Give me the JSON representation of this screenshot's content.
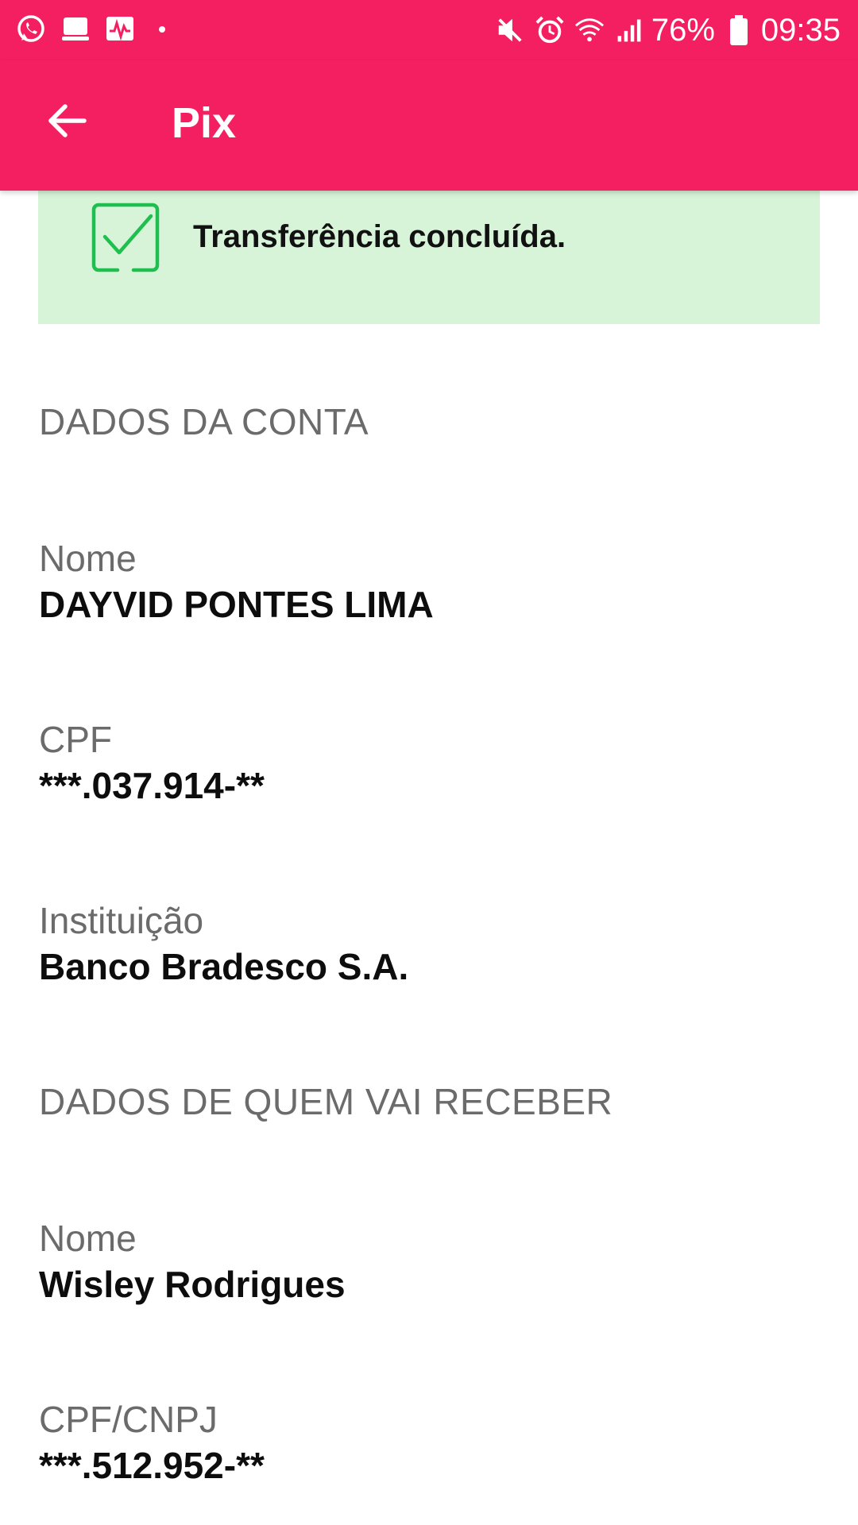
{
  "status_bar": {
    "battery_percent": "76%",
    "time": "09:35",
    "left_icons": [
      "whatsapp-icon",
      "app-stack-icon",
      "pulse-icon"
    ],
    "right_icons": [
      "mute-icon",
      "alarm-icon",
      "wifi-icon",
      "signal-icon",
      "battery-icon"
    ]
  },
  "app_bar": {
    "title": "Pix",
    "back_icon": "back-arrow-icon",
    "background_color": "#f31f60"
  },
  "banner": {
    "text": "Transferência concluída.",
    "icon": "check-square-icon",
    "background_color": "#d7f4d8",
    "icon_color": "#1fbf4f"
  },
  "account_section": {
    "title": "DADOS DA CONTA",
    "fields": [
      {
        "label": "Nome",
        "value": "DAYVID PONTES LIMA"
      },
      {
        "label": "CPF",
        "value": "***.037.914-**"
      },
      {
        "label": "Instituição",
        "value": "Banco Bradesco S.A."
      }
    ]
  },
  "recipient_section": {
    "title": "DADOS DE QUEM VAI RECEBER",
    "fields": [
      {
        "label": "Nome",
        "value": "Wisley Rodrigues"
      },
      {
        "label": "CPF/CNPJ",
        "value": "***.512.952-**"
      }
    ]
  }
}
